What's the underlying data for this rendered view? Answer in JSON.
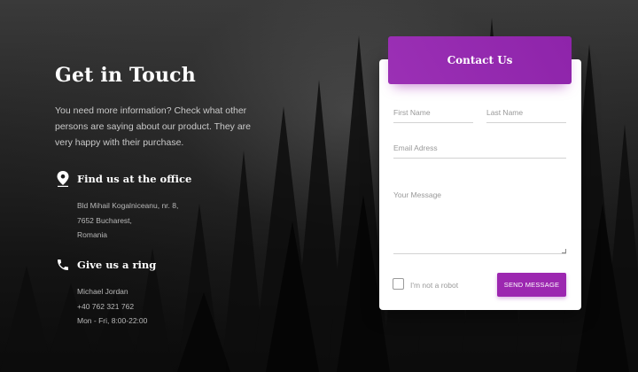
{
  "left": {
    "title": "Get in Touch",
    "description": "You need more information? Check what other persons are saying about our product. They are very happy with their purchase."
  },
  "office": {
    "icon": "location-pin-icon",
    "title": "Find us at the office",
    "lines": [
      "Bld Mihail Kogalniceanu, nr. 8,",
      "7652 Bucharest,",
      "Romania"
    ]
  },
  "ring": {
    "icon": "phone-icon",
    "title": "Give us a ring",
    "lines": [
      "Michael Jordan",
      "+40 762 321 762",
      "Mon - Fri, 8:00-22:00"
    ]
  },
  "form": {
    "header": "Contact Us",
    "first_name_placeholder": "First Name",
    "last_name_placeholder": "Last Name",
    "email_placeholder": "Email Adress",
    "message_placeholder": "Your Message",
    "robot_label": "I'm not a robot",
    "send_label": "SEND MESSAGE",
    "accent_color": "#9c27b0"
  }
}
